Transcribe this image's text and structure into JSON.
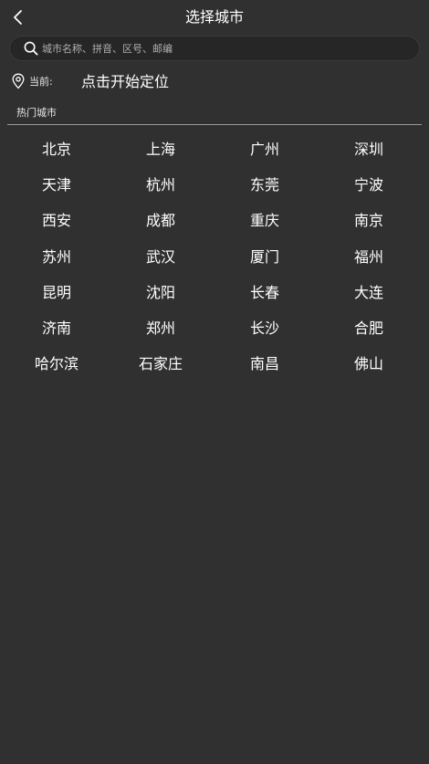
{
  "header": {
    "back_icon": "chevron-left-icon",
    "title": "选择城市"
  },
  "search": {
    "icon": "search-icon",
    "placeholder": "城市名称、拼音、区号、邮编",
    "value": ""
  },
  "current_location": {
    "icon": "location-pin-icon",
    "label": "当前:",
    "action": "点击开始定位"
  },
  "hot_cities": {
    "title": "热门城市",
    "cities": [
      "北京",
      "上海",
      "广州",
      "深圳",
      "天津",
      "杭州",
      "东莞",
      "宁波",
      "西安",
      "成都",
      "重庆",
      "南京",
      "苏州",
      "武汉",
      "厦门",
      "福州",
      "昆明",
      "沈阳",
      "长春",
      "大连",
      "济南",
      "郑州",
      "长沙",
      "合肥",
      "哈尔滨",
      "石家庄",
      "南昌",
      "佛山"
    ]
  },
  "colors": {
    "background": "#303030",
    "search_background": "#262626",
    "text": "#ffffff",
    "divider": "#9a9a9a"
  }
}
